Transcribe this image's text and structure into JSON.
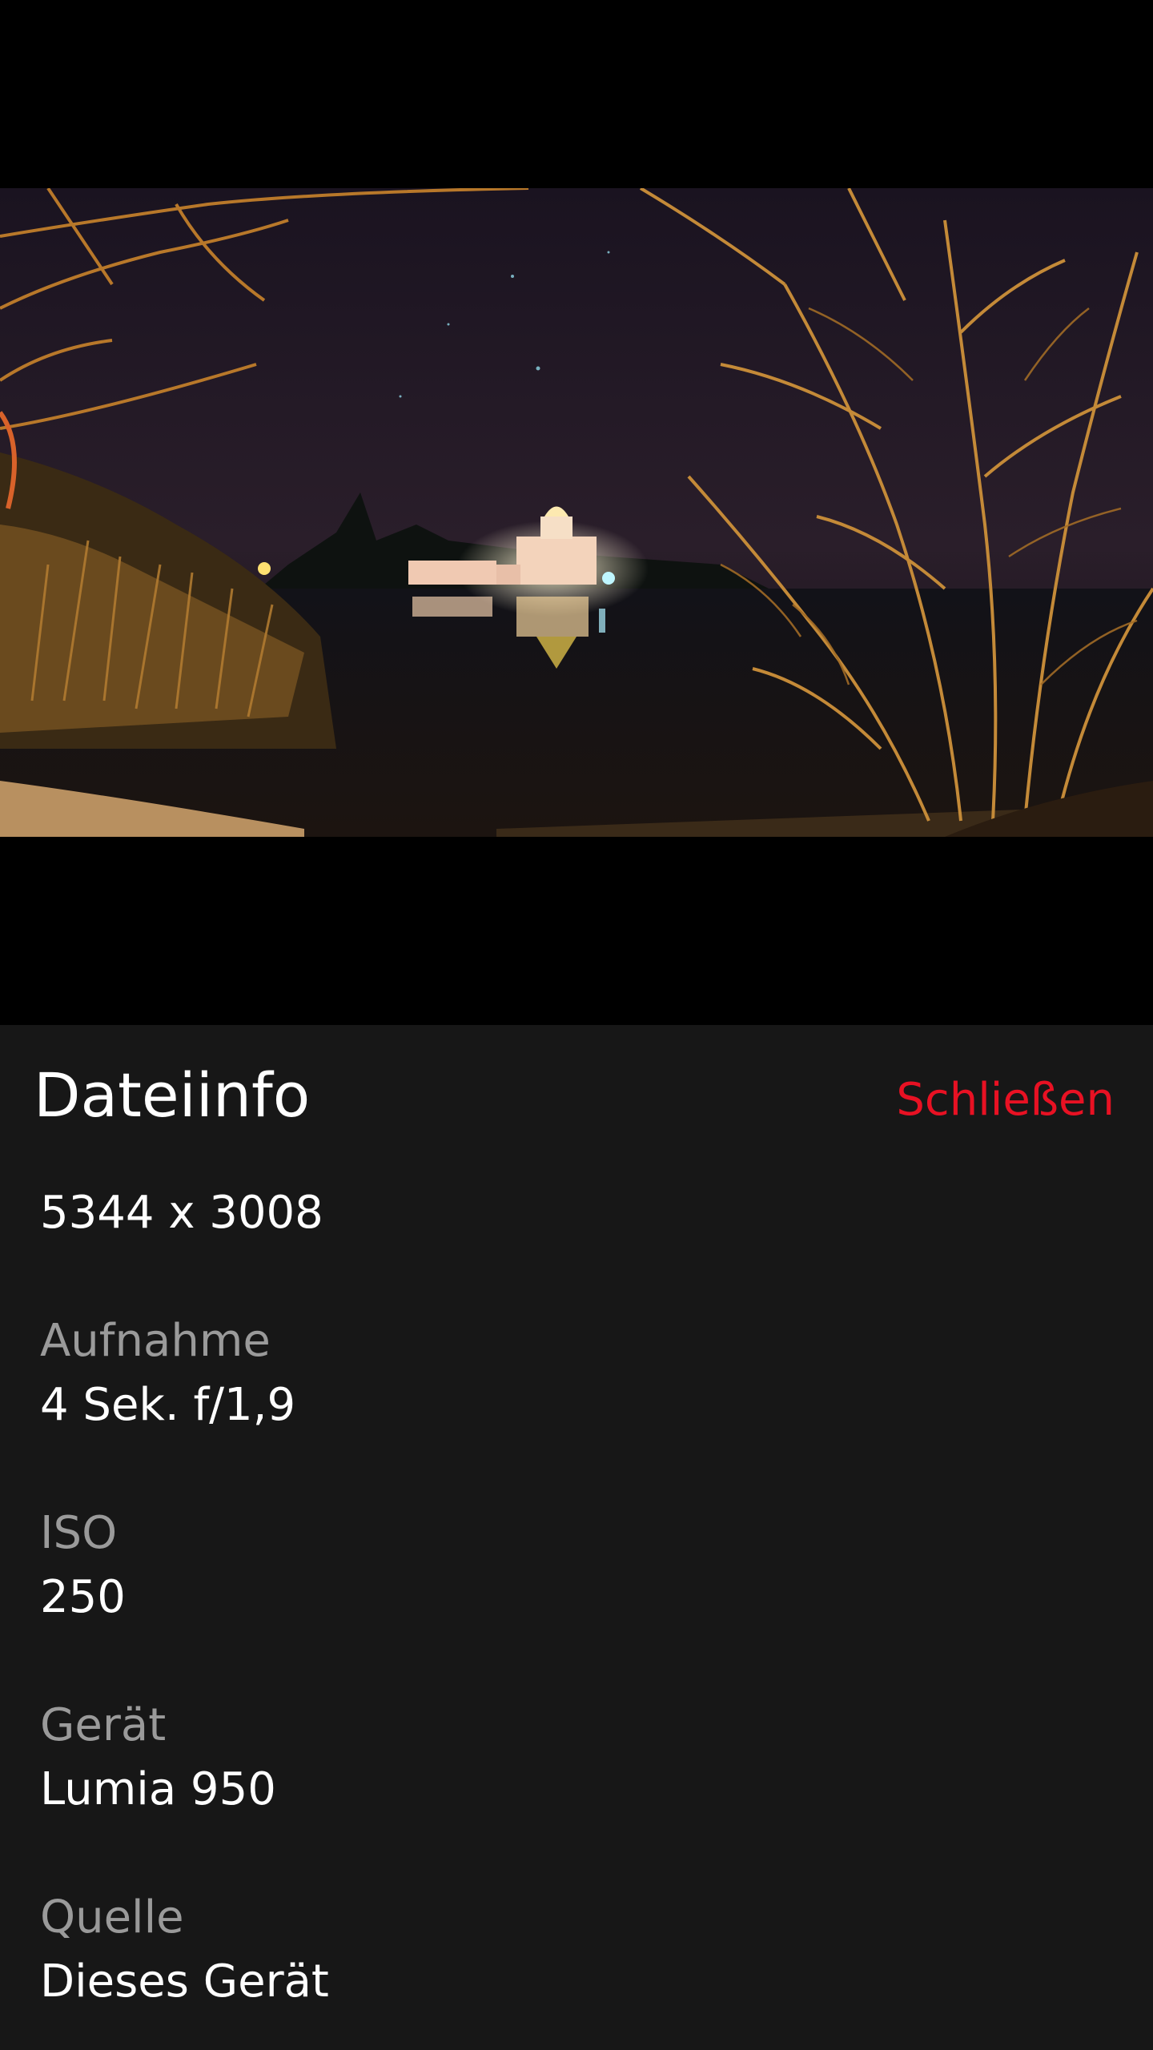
{
  "panel": {
    "title": "Dateiinfo",
    "close_label": "Schließen",
    "accent_color": "#e81123",
    "background_color": "#171717"
  },
  "photo": {
    "description_icon": "night-lake-palace-photo"
  },
  "info": {
    "resolution": "5344 x 3008",
    "exposure_label": "Aufnahme",
    "exposure_value": "4 Sek. f/1,9",
    "iso_label": "ISO",
    "iso_value": "250",
    "device_label": "Gerät",
    "device_value": "Lumia 950",
    "source_label": "Quelle",
    "source_value": "Dieses Gerät"
  }
}
